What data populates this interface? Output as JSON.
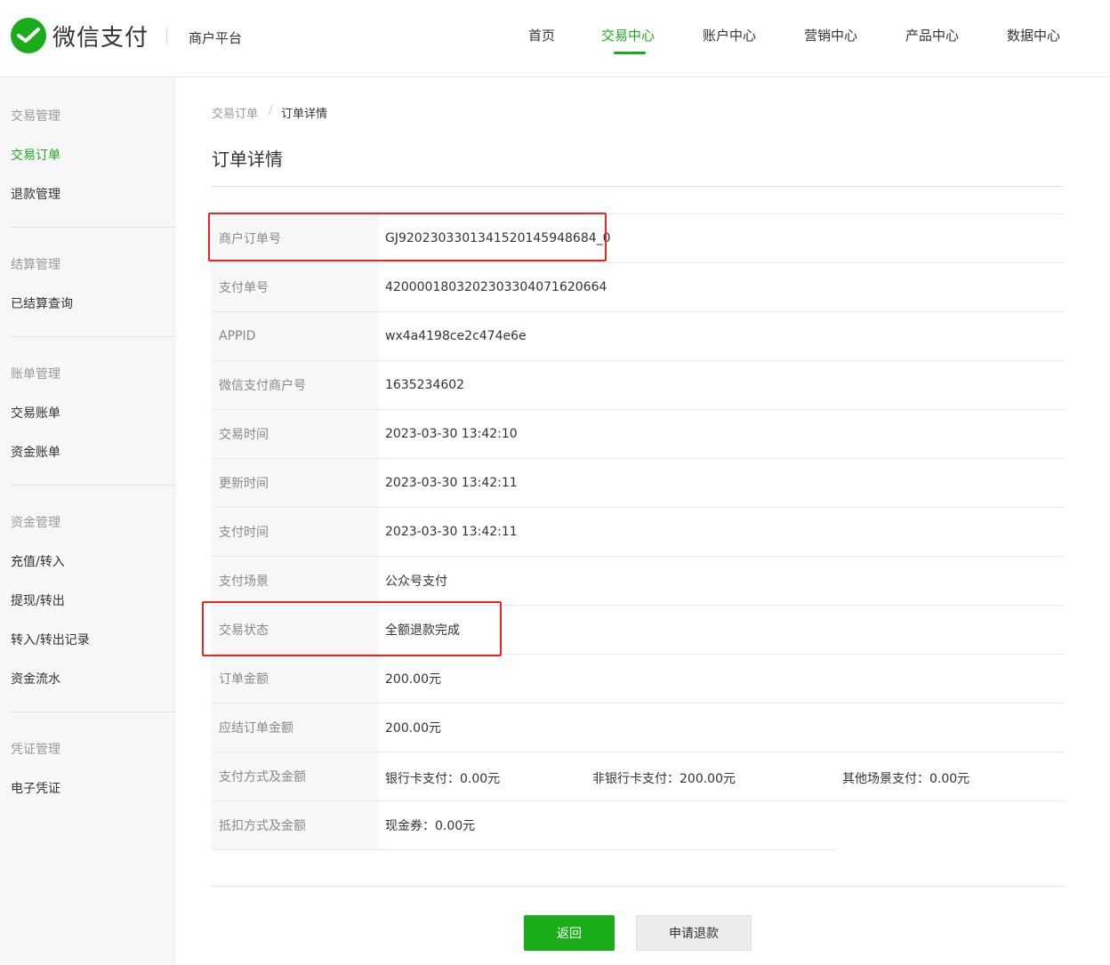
{
  "header": {
    "brand": "微信支付",
    "platform": "商户平台",
    "nav": [
      "首页",
      "交易中心",
      "账户中心",
      "营销中心",
      "产品中心",
      "数据中心"
    ],
    "active_nav": "交易中心",
    "accent_color": "#1aad19"
  },
  "sidebar": {
    "groups": [
      {
        "title": "交易管理",
        "items": [
          "交易订单",
          "退款管理"
        ]
      },
      {
        "title": "结算管理",
        "items": [
          "已结算查询"
        ]
      },
      {
        "title": "账单管理",
        "items": [
          "交易账单",
          "资金账单"
        ]
      },
      {
        "title": "资金管理",
        "items": [
          "充值/转入",
          "提现/转出",
          "转入/转出记录",
          "资金流水"
        ]
      },
      {
        "title": "凭证管理",
        "items": [
          "电子凭证"
        ]
      }
    ],
    "active_item": "交易订单"
  },
  "breadcrumb": {
    "parent": "交易订单",
    "separator": "/",
    "current": "订单详情"
  },
  "page_title": "订单详情",
  "details": [
    {
      "label": "商户订单号",
      "value": "GJ920230330134152014594868 4_0"
    },
    {
      "label": "支付单号",
      "value": "4200001803202303304071620664"
    },
    {
      "label": "APPID",
      "value": "wx4a4198ce2c474e6e"
    },
    {
      "label": "微信支付商户号",
      "value": "1635234602"
    },
    {
      "label": "交易时间",
      "value": "2023-03-30 13:42:10"
    },
    {
      "label": "更新时间",
      "value": "2023-03-30 13:42:11"
    },
    {
      "label": "支付时间",
      "value": "2023-03-30 13:42:11"
    },
    {
      "label": "支付场景",
      "value": "公众号支付"
    },
    {
      "label": "交易状态",
      "value": "全额退款完成"
    },
    {
      "label": "订单金额",
      "value": "200.00元"
    },
    {
      "label": "应结订单金额",
      "value": "200.00元"
    }
  ],
  "payment_methods": {
    "label": "支付方式及金额",
    "bank_card": "银行卡支付：0.00元",
    "non_bank_card": "非银行卡支付：200.00元",
    "other": "其他场景支付：0.00元"
  },
  "deduction": {
    "label": "抵扣方式及金额",
    "value": "现金券：0.00元"
  },
  "buttons": {
    "back": "返回",
    "refund": "申请退款"
  },
  "highlight_color": "#e8271f"
}
